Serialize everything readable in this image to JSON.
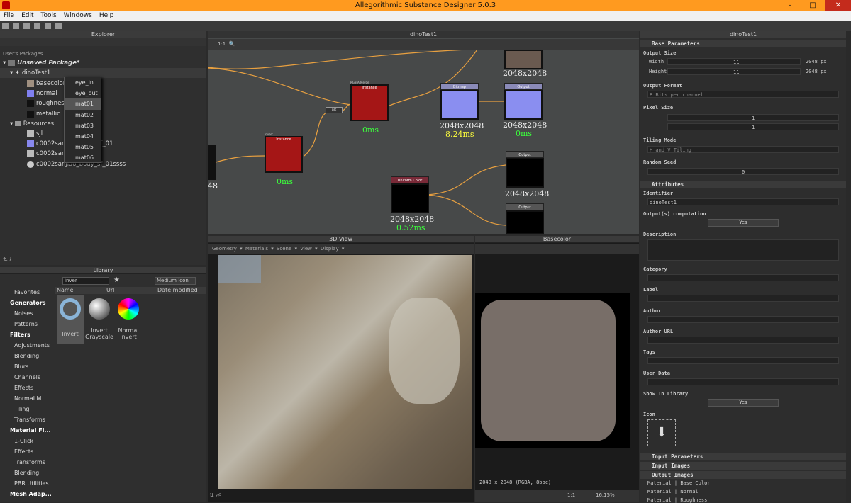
{
  "window": {
    "title": "Allegorithmic Substance Designer 5.0.3"
  },
  "menu": [
    "File",
    "Edit",
    "Tools",
    "Windows",
    "Help"
  ],
  "explorer": {
    "title": "Explorer",
    "section": "User's Packages",
    "package": "Unsaved Package*",
    "graph": "dinoTest1",
    "outputs": [
      "basecolor",
      "normal",
      "roughness",
      "metallic"
    ],
    "resources_label": "Resources",
    "resources": [
      "sjl",
      "c0002sanjiao_body_sf_01",
      "c0002sanjiao",
      "c0002sanjiao_body_sf_01ssss"
    ],
    "context_menu": [
      "eye_in",
      "eye_out",
      "mat01",
      "mat02",
      "mat03",
      "mat04",
      "mat05",
      "mat06"
    ],
    "context_selected": "mat01"
  },
  "library": {
    "title": "Library",
    "search": "inver",
    "view_mode": "Medium Icon",
    "columns": [
      "Name",
      "Url",
      "Date modified"
    ],
    "categories": [
      {
        "label": "Favorites",
        "header": false
      },
      {
        "label": "Generators",
        "header": true
      },
      {
        "label": "Noises",
        "header": false
      },
      {
        "label": "Patterns",
        "header": false
      },
      {
        "label": "Filters",
        "header": true
      },
      {
        "label": "Adjustments",
        "header": false
      },
      {
        "label": "Blending",
        "header": false
      },
      {
        "label": "Blurs",
        "header": false
      },
      {
        "label": "Channels",
        "header": false
      },
      {
        "label": "Effects",
        "header": false
      },
      {
        "label": "Normal M...",
        "header": false
      },
      {
        "label": "Tiling",
        "header": false
      },
      {
        "label": "Transforms",
        "header": false
      },
      {
        "label": "Material Fi...",
        "header": true
      },
      {
        "label": "1-Click",
        "header": false
      },
      {
        "label": "Effects",
        "header": false
      },
      {
        "label": "Transforms",
        "header": false
      },
      {
        "label": "Blending",
        "header": false
      },
      {
        "label": "PBR Utilities",
        "header": false
      },
      {
        "label": "Mesh Adap...",
        "header": true
      }
    ],
    "items": [
      {
        "label": "Invert"
      },
      {
        "label": "Invert Grayscale"
      },
      {
        "label": "Normal Invert"
      }
    ]
  },
  "graph": {
    "title": "dinoTest1",
    "zoom": "1:1",
    "nodes": [
      {
        "header": "RGB-A Merge",
        "body": "Instance",
        "time": "0ms"
      },
      {
        "header": "Invert",
        "body": "Instance",
        "time": "0ms"
      },
      {
        "header": "Bitmap",
        "size": "2048x2048",
        "time": "8.24ms"
      },
      {
        "header": "Output",
        "size": "2048x2048",
        "time": "0ms"
      },
      {
        "header": "Uniform Color",
        "size": "2048x2048",
        "time": "0.52ms"
      },
      {
        "header": "Output",
        "size": "2048x2048"
      },
      {
        "header": "Output"
      }
    ],
    "top_size": "2048x2048",
    "left_size": "48",
    "small_node": "alt"
  },
  "view3d": {
    "title": "3D View",
    "menu": [
      "Geometry",
      "Materials",
      "Scene",
      "View",
      "Display"
    ]
  },
  "view2d": {
    "title": "Basecolor",
    "status": "2048 x 2048 (RGBA, 8bpc)",
    "zoom": "16.15%",
    "ratio": "1:1"
  },
  "props": {
    "title": "dinoTest1",
    "base_parameters": "Base Parameters",
    "output_size": "Output Size",
    "width_label": "Width",
    "width_value": "11",
    "width_px": "2048 px",
    "height_label": "Height",
    "height_value": "11",
    "height_px": "2048 px",
    "output_format": "Output Format",
    "format_value": "8 Bits per channel",
    "pixel_size": "Pixel Size",
    "px_width": "1",
    "px_height": "1",
    "tiling_mode": "Tiling Mode",
    "tiling_value": "H and V Tiling",
    "random_seed": "Random Seed",
    "seed_value": "0",
    "attributes": "Attributes",
    "identifier": "Identifier",
    "identifier_value": "dinoTest1",
    "outputs_computation": "Output(s) computation",
    "yes": "Yes",
    "description": "Description",
    "category": "Category",
    "label": "Label",
    "author": "Author",
    "author_url": "Author URL",
    "tags": "Tags",
    "user_data": "User Data",
    "show_in_library": "Show In Library",
    "icon": "Icon",
    "input_parameters": "Input Parameters",
    "input_images": "Input Images",
    "output_images": "Output Images",
    "output_list": [
      "Material | Base Color",
      "Material | Normal",
      "Material | Roughness"
    ]
  },
  "colors": {
    "accent": "#ff9a1f",
    "node_red": "#a51616",
    "time_green": "#3cff3c",
    "time_yellow": "#ffff3c",
    "wire": "#e8a040"
  }
}
